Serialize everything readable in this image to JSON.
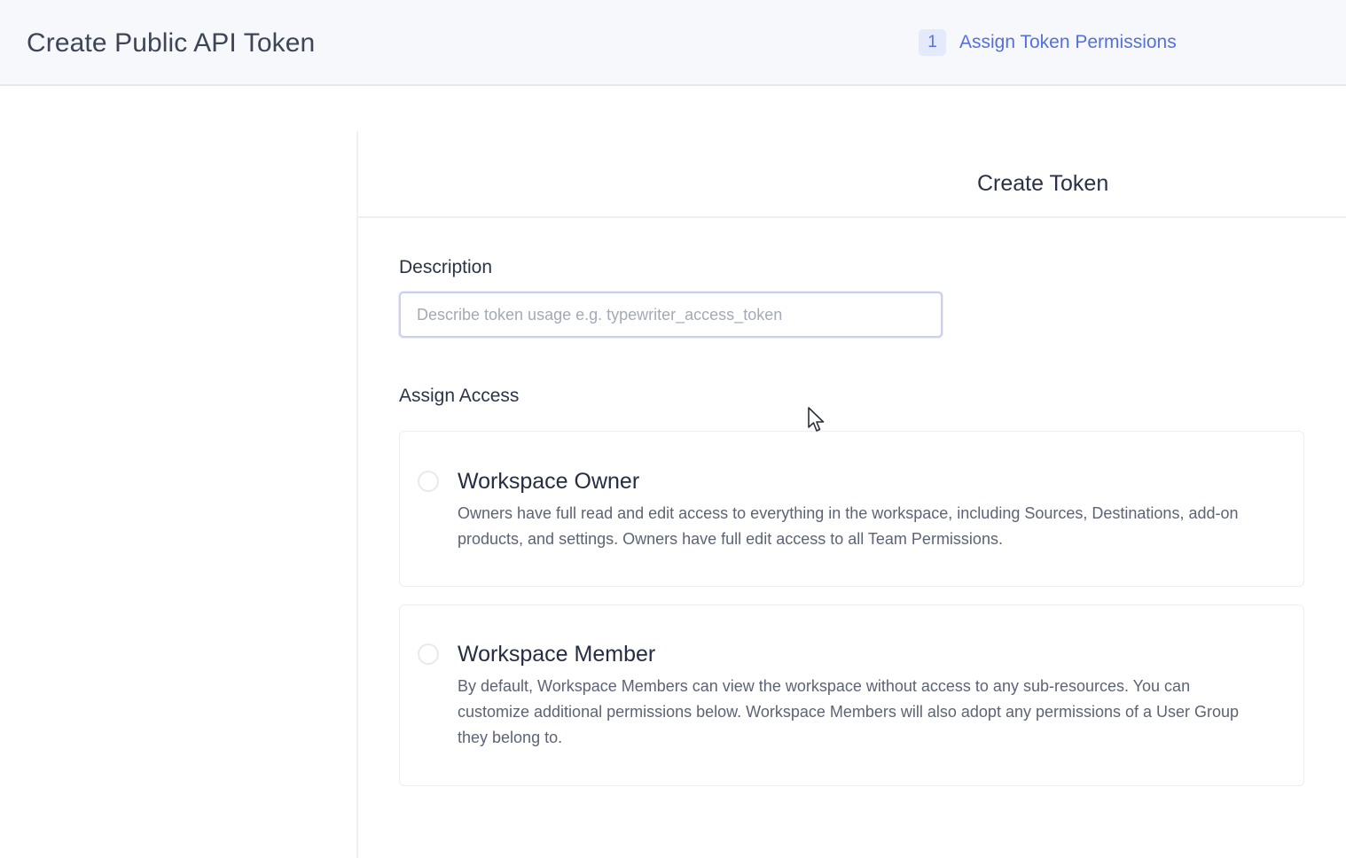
{
  "header": {
    "title": "Create Public API Token",
    "step": {
      "number": "1",
      "label": "Assign Token Permissions"
    }
  },
  "panel": {
    "title": "Create Token",
    "description": {
      "label": "Description",
      "value": "",
      "placeholder": "Describe token usage e.g. typewriter_access_token"
    },
    "assign_access": {
      "label": "Assign Access",
      "options": [
        {
          "title": "Workspace Owner",
          "description": "Owners have full read and edit access to everything in the workspace, including Sources, Destinations, add-on products, and settings. Owners have full edit access to all Team Permissions.",
          "selected": false
        },
        {
          "title": "Workspace Member",
          "description": "By default, Workspace Members can view the workspace without access to any sub-resources. You can customize additional permissions below. Workspace Members will also adopt any permissions of a User Group they belong to.",
          "selected": false
        }
      ]
    }
  },
  "colors": {
    "accent": "#5470dd",
    "step_badge_bg": "#e4e9fb",
    "header_bg": "#f7f8fb"
  }
}
